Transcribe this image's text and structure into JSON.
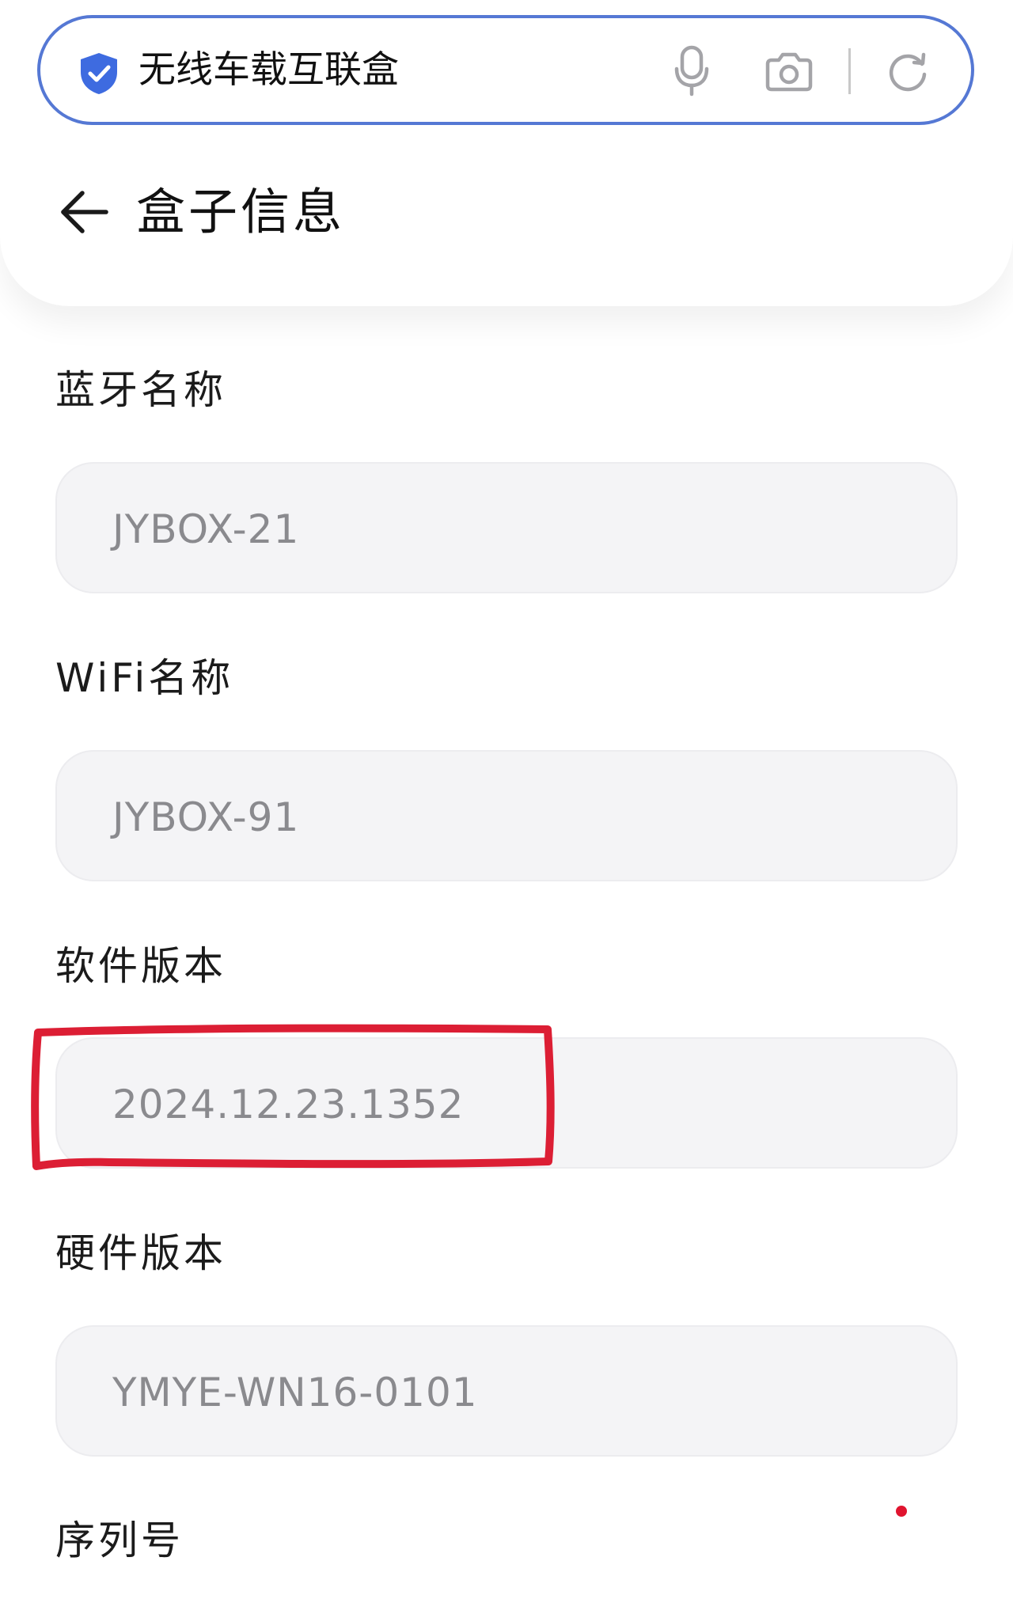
{
  "search": {
    "query": "无线车载互联盒",
    "accent_color": "#5578d4",
    "icons": {
      "shield": "shield-check-icon",
      "mic": "microphone-icon",
      "camera": "camera-icon",
      "refresh": "refresh-icon"
    }
  },
  "header": {
    "back_icon": "arrow-left-icon",
    "title": "盒子信息"
  },
  "fields": [
    {
      "label": "蓝牙名称",
      "value": "JYBOX-21"
    },
    {
      "label": "WiFi名称",
      "value": "JYBOX-91"
    },
    {
      "label": "软件版本",
      "value": "2024.12.23.1352"
    },
    {
      "label": "硬件版本",
      "value": "YMYE-WN16-0101"
    },
    {
      "label": "序列号",
      "value": ""
    }
  ],
  "annotation": {
    "highlighted_field": "软件版本",
    "color": "#dc1e34"
  },
  "notice_dot_color": "#e0142f"
}
